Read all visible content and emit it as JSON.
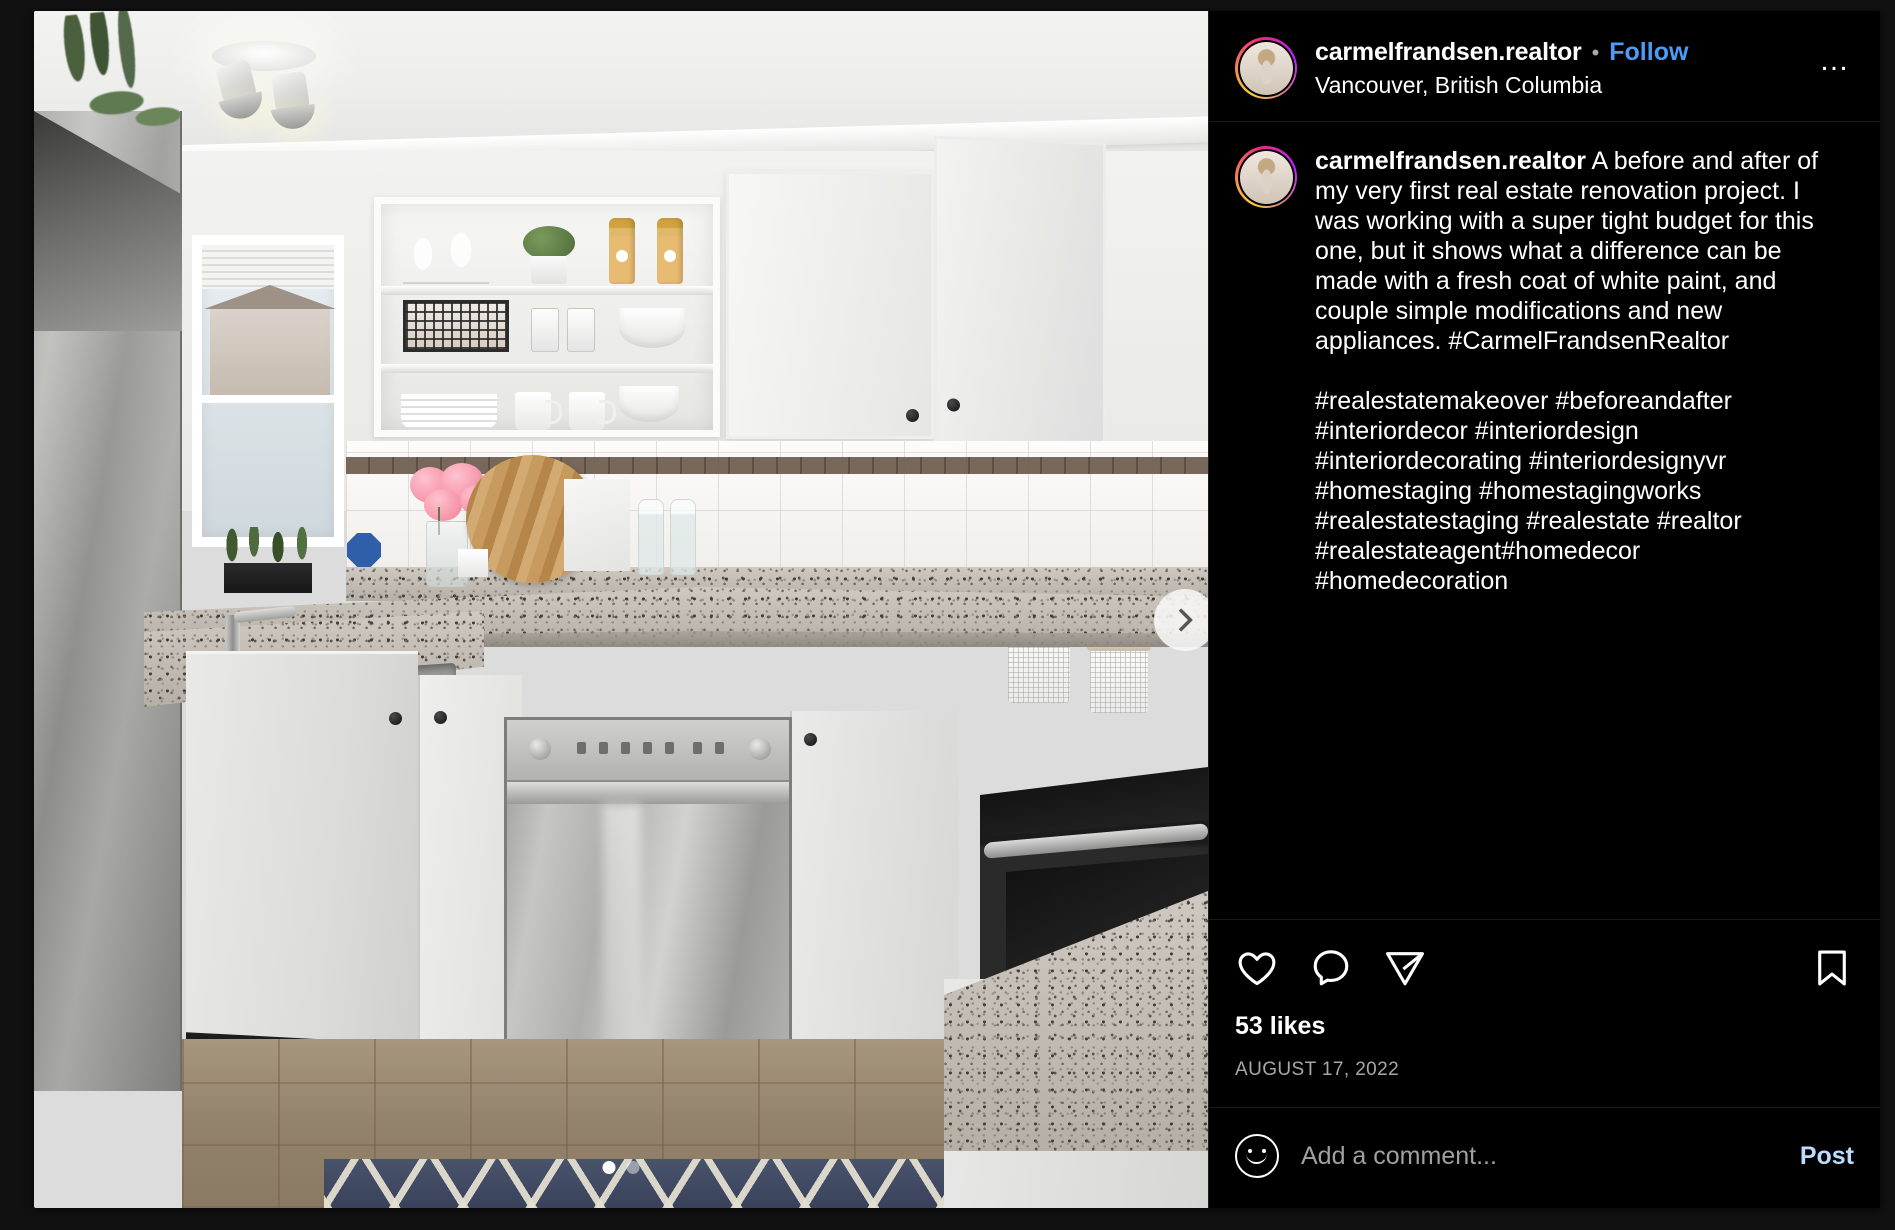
{
  "post": {
    "header": {
      "username": "carmelfrandsen.realtor",
      "separator": "•",
      "follow_label": "Follow",
      "location": "Vancouver, British Columbia",
      "more_options": "…"
    },
    "caption": {
      "username": "carmelfrandsen.realtor",
      "body": " A before and after of my very first real estate renovation project. I was working with a super tight budget for this one, but it shows what a difference can be made with a fresh coat of white paint, and couple simple modifications and new appliances. #CarmelFrandsenRealtor\n\n#realestatemakeover #beforeandafter #interiordecor #interiordesign #interiordecorating #interiordesignyvr #homestaging #homestagingworks #realestatestaging #realestate #realtor #realestateagent#homedecor #homedecoration"
    },
    "actions": {
      "like": "like-icon",
      "comment": "comment-icon",
      "share": "share-icon",
      "save": "save-icon"
    },
    "likes": "53 likes",
    "date": "AUGUST 17, 2022",
    "comment_bar": {
      "emoji": "emoji-icon",
      "placeholder": "Add a comment...",
      "value": "",
      "post_label": "Post"
    },
    "media": {
      "carousel": {
        "next_label": "›",
        "total_slides": 2,
        "active_slide": 1
      },
      "alt": "Renovated white kitchen with open shelving, stainless dishwasher, granite counters and navy diamond rug"
    },
    "colors": {
      "background": "#000000",
      "page_background": "#111111",
      "link_blue": "#4a9cf6",
      "post_blue": "#bcdcff",
      "muted_text": "#a8a8a8",
      "text": "#ffffff",
      "divider": "#1b1b1b"
    }
  }
}
